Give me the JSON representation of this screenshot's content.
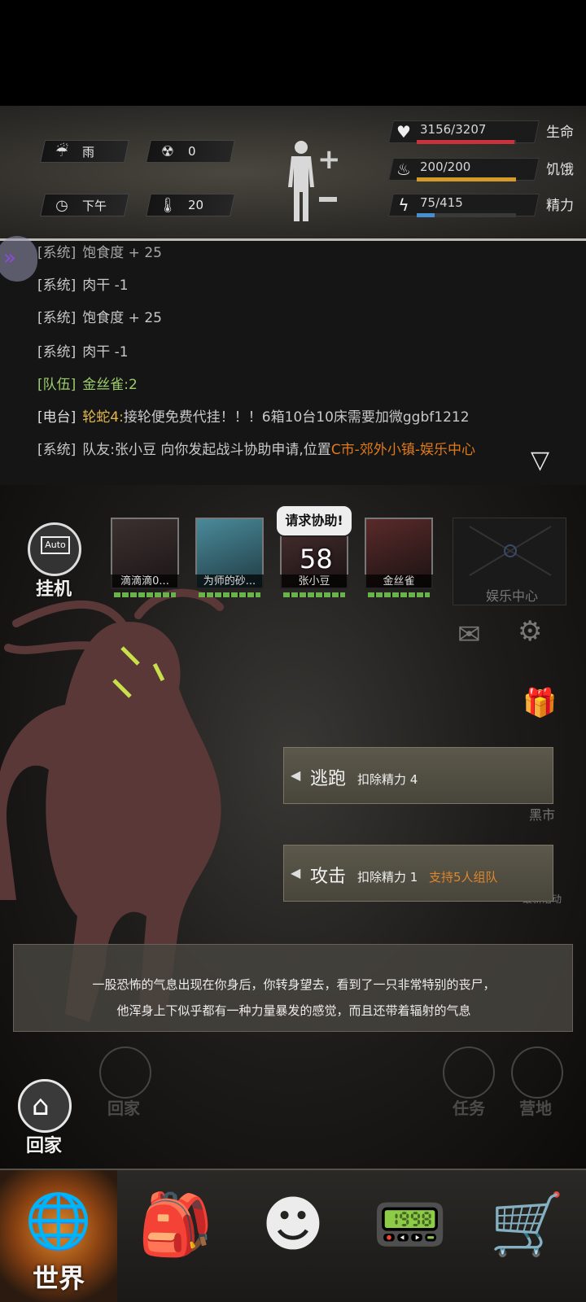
{
  "status": {
    "weather": "雨",
    "radiation": "0",
    "time_of_day": "下午",
    "temperature": "20",
    "health": {
      "value": "3156/3207",
      "label": "生命",
      "fraction": 0.984,
      "color": "#c8323a"
    },
    "hunger": {
      "value": "200/200",
      "label": "饥饿",
      "fraction": 1.0,
      "color": "#d49a2a"
    },
    "energy": {
      "value": "75/415",
      "label": "精力",
      "fraction": 0.181,
      "color": "#4a8ed0"
    }
  },
  "chat": {
    "lines": [
      {
        "tag": "[系统]",
        "text": "饱食度 + 25"
      },
      {
        "tag": "[系统]",
        "text": "肉干 -1"
      },
      {
        "tag": "[系统]",
        "text": "饱食度 + 25"
      },
      {
        "tag": "[系统]",
        "text": "肉干 -1"
      }
    ],
    "team": {
      "tag": "[队伍]",
      "text": "金丝雀:2"
    },
    "radio": {
      "tag": "[电台]",
      "name": "轮蛇4:",
      "text": "接轮便免费代挂！！！6箱10台10床需要加微ggbf1212"
    },
    "assist": {
      "tag": "[系统]",
      "text": "队友:张小豆 向你发起战斗协助申请,位置",
      "location": "C市-郊外小镇-娱乐中心"
    }
  },
  "party": {
    "auto_label": "挂机",
    "auto_screen": "Auto",
    "members": [
      {
        "name": "滴滴滴0..."
      },
      {
        "name": "为师的砂..."
      },
      {
        "name": "张小豆"
      },
      {
        "name": "金丝雀"
      }
    ],
    "help_bubble": "请求协助!",
    "countdown": "58",
    "location_card": "娱乐中心"
  },
  "side_menu": {
    "black_market": "黑市",
    "event": "最新活动"
  },
  "actions": {
    "flee": {
      "verb": "逃跑",
      "cost": "扣除精力 4"
    },
    "attack": {
      "verb": "攻击",
      "cost": "扣除精力 1",
      "extra": "支持5人组队"
    }
  },
  "description": {
    "line1": "一股恐怖的气息出现在你身后，你转身望去，看到了一只非常特别的丧尸，",
    "line2": "他浑身上下似乎都有一种力量暴发的感觉，而且还带着辐射的气息"
  },
  "scene_buttons": {
    "home": "回家",
    "home_dim": "回家",
    "task": "任务",
    "camp": "营地"
  },
  "bottom_nav": {
    "world": "世界"
  }
}
